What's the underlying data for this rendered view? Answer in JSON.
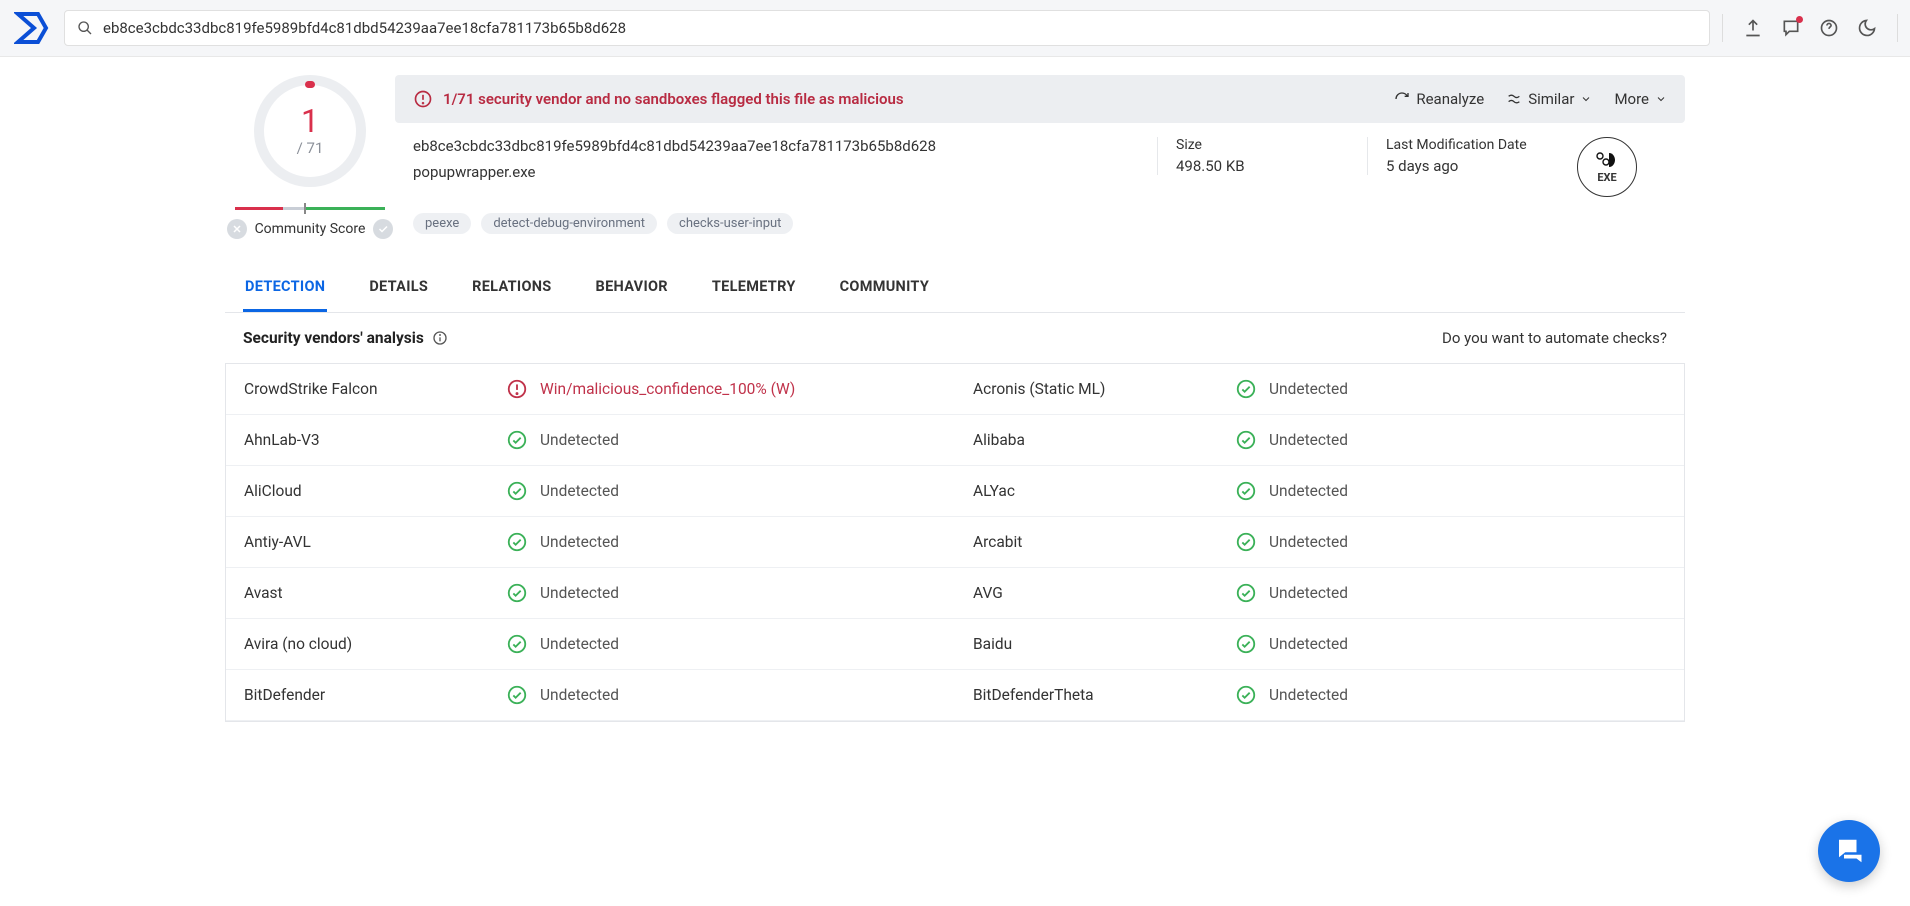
{
  "search": {
    "value": "eb8ce3cbdc33dbc819fe5989bfd4c81dbd54239aa7ee18cfa781173b65b8d628"
  },
  "score": {
    "detections": "1",
    "total": "/ 71",
    "community_label": "Community Score"
  },
  "alert": {
    "message": "1/71 security vendor and no sandboxes flagged this file as malicious",
    "reanalyze": "Reanalyze",
    "similar": "Similar",
    "more": "More"
  },
  "file": {
    "hash": "eb8ce3cbdc33dbc819fe5989bfd4c81dbd54239aa7ee18cfa781173b65b8d628",
    "name": "popupwrapper.exe",
    "size_label": "Size",
    "size": "498.50 KB",
    "mod_label": "Last Modification Date",
    "mod": "5 days ago",
    "type": "EXE"
  },
  "tags": [
    "peexe",
    "detect-debug-environment",
    "checks-user-input"
  ],
  "tabs": [
    "DETECTION",
    "DETAILS",
    "RELATIONS",
    "BEHAVIOR",
    "TELEMETRY",
    "COMMUNITY"
  ],
  "section": {
    "title": "Security vendors' analysis",
    "automate": "Do you want to automate checks?"
  },
  "results": {
    "undetected_label": "Undetected",
    "rows": [
      {
        "left": {
          "vendor": "CrowdStrike Falcon",
          "status": "malicious",
          "text": "Win/malicious_confidence_100% (W)"
        },
        "right": {
          "vendor": "Acronis (Static ML)",
          "status": "undetected"
        }
      },
      {
        "left": {
          "vendor": "AhnLab-V3",
          "status": "undetected"
        },
        "right": {
          "vendor": "Alibaba",
          "status": "undetected"
        }
      },
      {
        "left": {
          "vendor": "AliCloud",
          "status": "undetected"
        },
        "right": {
          "vendor": "ALYac",
          "status": "undetected"
        }
      },
      {
        "left": {
          "vendor": "Antiy-AVL",
          "status": "undetected"
        },
        "right": {
          "vendor": "Arcabit",
          "status": "undetected"
        }
      },
      {
        "left": {
          "vendor": "Avast",
          "status": "undetected"
        },
        "right": {
          "vendor": "AVG",
          "status": "undetected"
        }
      },
      {
        "left": {
          "vendor": "Avira (no cloud)",
          "status": "undetected"
        },
        "right": {
          "vendor": "Baidu",
          "status": "undetected"
        }
      },
      {
        "left": {
          "vendor": "BitDefender",
          "status": "undetected"
        },
        "right": {
          "vendor": "BitDefenderTheta",
          "status": "undetected"
        }
      }
    ]
  }
}
